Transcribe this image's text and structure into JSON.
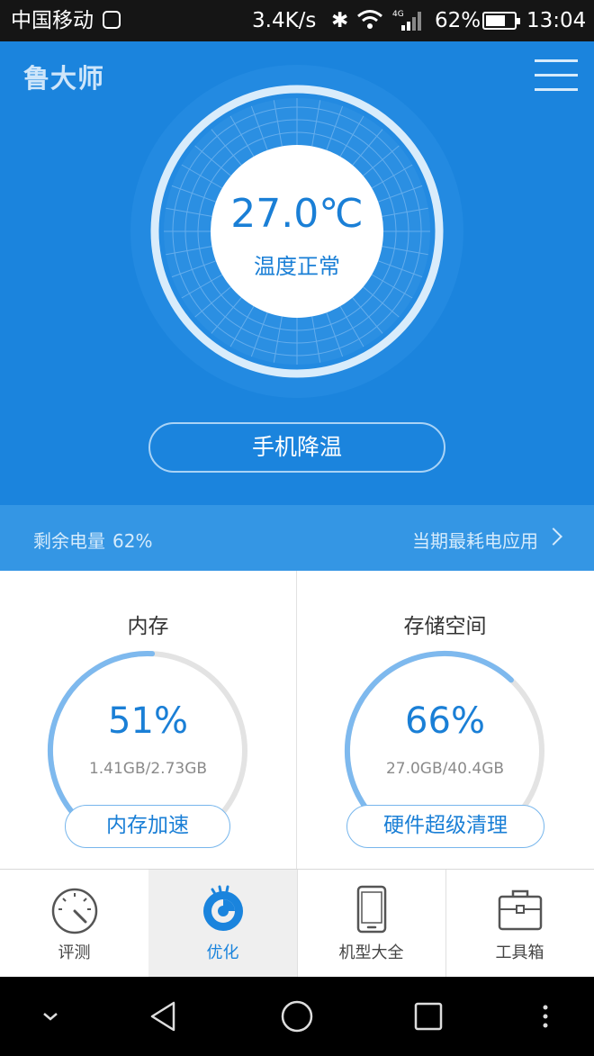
{
  "status_bar": {
    "carrier": "中国移动",
    "speed": "3.4K/s",
    "network": "4G",
    "battery_pct": "62%",
    "battery_level": 0.62,
    "time": "13:04"
  },
  "header": {
    "logo": "鲁大师",
    "menu_icon": "hamburger-menu-icon"
  },
  "temperature": {
    "value": "27.0℃",
    "status": "温度正常",
    "action_label": "手机降温"
  },
  "battery": {
    "label": "剩余电量",
    "value": "62%",
    "link_label": "当期最耗电应用"
  },
  "cards": [
    {
      "title": "内存",
      "percent": "51%",
      "level": 0.51,
      "usage": "1.41GB/2.73GB",
      "action_label": "内存加速"
    },
    {
      "title": "存储空间",
      "percent": "66%",
      "level": 0.66,
      "usage": "27.0GB/40.4GB",
      "action_label": "硬件超级清理"
    }
  ],
  "nav": [
    {
      "label": "评测",
      "icon": "speedometer-icon",
      "active": false
    },
    {
      "label": "优化",
      "icon": "optimize-icon",
      "active": true
    },
    {
      "label": "机型大全",
      "icon": "phone-icon",
      "active": false
    },
    {
      "label": "工具箱",
      "icon": "toolbox-icon",
      "active": false
    }
  ],
  "colors": {
    "primary": "#1b84dd",
    "strip": "#3496e4",
    "accent_text": "#1a7fd6",
    "ring_fill": "#7eb9ee",
    "ring_track": "#e3e3e3"
  }
}
